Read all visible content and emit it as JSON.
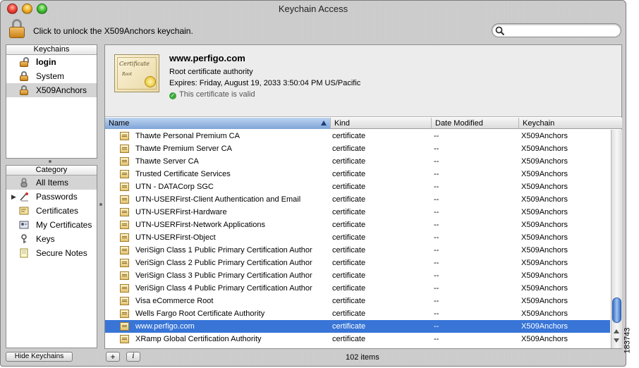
{
  "window": {
    "title": "Keychain Access"
  },
  "toolbar": {
    "unlock_message": "Click to unlock the X509Anchors keychain.",
    "search_value": ""
  },
  "keychains": {
    "header": "Keychains",
    "items": [
      {
        "label": "login",
        "bold": true
      },
      {
        "label": "System"
      },
      {
        "label": "X509Anchors",
        "selected": true
      }
    ]
  },
  "category": {
    "header": "Category",
    "items": [
      {
        "label": "All Items",
        "icon": "all-items-icon",
        "selected": true
      },
      {
        "label": "Passwords",
        "icon": "passwords-icon",
        "expandable": true
      },
      {
        "label": "Certificates",
        "icon": "certificates-icon"
      },
      {
        "label": "My Certificates",
        "icon": "my-certificates-icon"
      },
      {
        "label": "Keys",
        "icon": "keys-icon"
      },
      {
        "label": "Secure Notes",
        "icon": "secure-notes-icon"
      }
    ]
  },
  "detail": {
    "image_title": "Certificate",
    "image_subtitle": "Root",
    "name": "www.perfigo.com",
    "type": "Root certificate authority",
    "expires": "Expires: Friday, August 19, 2033 3:50:04 PM US/Pacific",
    "status": "This certificate is valid"
  },
  "table": {
    "columns": [
      "Name",
      "Kind",
      "Date Modified",
      "Keychain"
    ],
    "sorted_column": "Name",
    "rows": [
      {
        "name": "Thawte Personal Premium CA",
        "kind": "certificate",
        "date": "--",
        "keychain": "X509Anchors"
      },
      {
        "name": "Thawte Premium Server CA",
        "kind": "certificate",
        "date": "--",
        "keychain": "X509Anchors"
      },
      {
        "name": "Thawte Server CA",
        "kind": "certificate",
        "date": "--",
        "keychain": "X509Anchors"
      },
      {
        "name": "Trusted Certificate Services",
        "kind": "certificate",
        "date": "--",
        "keychain": "X509Anchors"
      },
      {
        "name": "UTN - DATACorp SGC",
        "kind": "certificate",
        "date": "--",
        "keychain": "X509Anchors"
      },
      {
        "name": "UTN-USERFirst-Client Authentication and Email",
        "kind": "certificate",
        "date": "--",
        "keychain": "X509Anchors"
      },
      {
        "name": "UTN-USERFirst-Hardware",
        "kind": "certificate",
        "date": "--",
        "keychain": "X509Anchors"
      },
      {
        "name": "UTN-USERFirst-Network Applications",
        "kind": "certificate",
        "date": "--",
        "keychain": "X509Anchors"
      },
      {
        "name": "UTN-USERFirst-Object",
        "kind": "certificate",
        "date": "--",
        "keychain": "X509Anchors"
      },
      {
        "name": "VeriSign Class 1 Public Primary Certification Author",
        "kind": "certificate",
        "date": "--",
        "keychain": "X509Anchors"
      },
      {
        "name": "VeriSign Class 2 Public Primary Certification Author",
        "kind": "certificate",
        "date": "--",
        "keychain": "X509Anchors"
      },
      {
        "name": "VeriSign Class 3 Public Primary Certification Author",
        "kind": "certificate",
        "date": "--",
        "keychain": "X509Anchors"
      },
      {
        "name": "VeriSign Class 4 Public Primary Certification Author",
        "kind": "certificate",
        "date": "--",
        "keychain": "X509Anchors"
      },
      {
        "name": "Visa eCommerce Root",
        "kind": "certificate",
        "date": "--",
        "keychain": "X509Anchors"
      },
      {
        "name": "Wells Fargo Root Certificate Authority",
        "kind": "certificate",
        "date": "--",
        "keychain": "X509Anchors"
      },
      {
        "name": "www.perfigo.com",
        "kind": "certificate",
        "date": "--",
        "keychain": "X509Anchors",
        "selected": true
      },
      {
        "name": "XRamp Global Certification Authority",
        "kind": "certificate",
        "date": "--",
        "keychain": "X509Anchors"
      }
    ]
  },
  "bottombar": {
    "hide_label": "Hide Keychains",
    "add_label": "+",
    "info_label": "i",
    "count": "102 items"
  },
  "side_label": "183743",
  "colors": {
    "selection": "#3875d7",
    "sidebar_selection": "#d4d4d4"
  }
}
